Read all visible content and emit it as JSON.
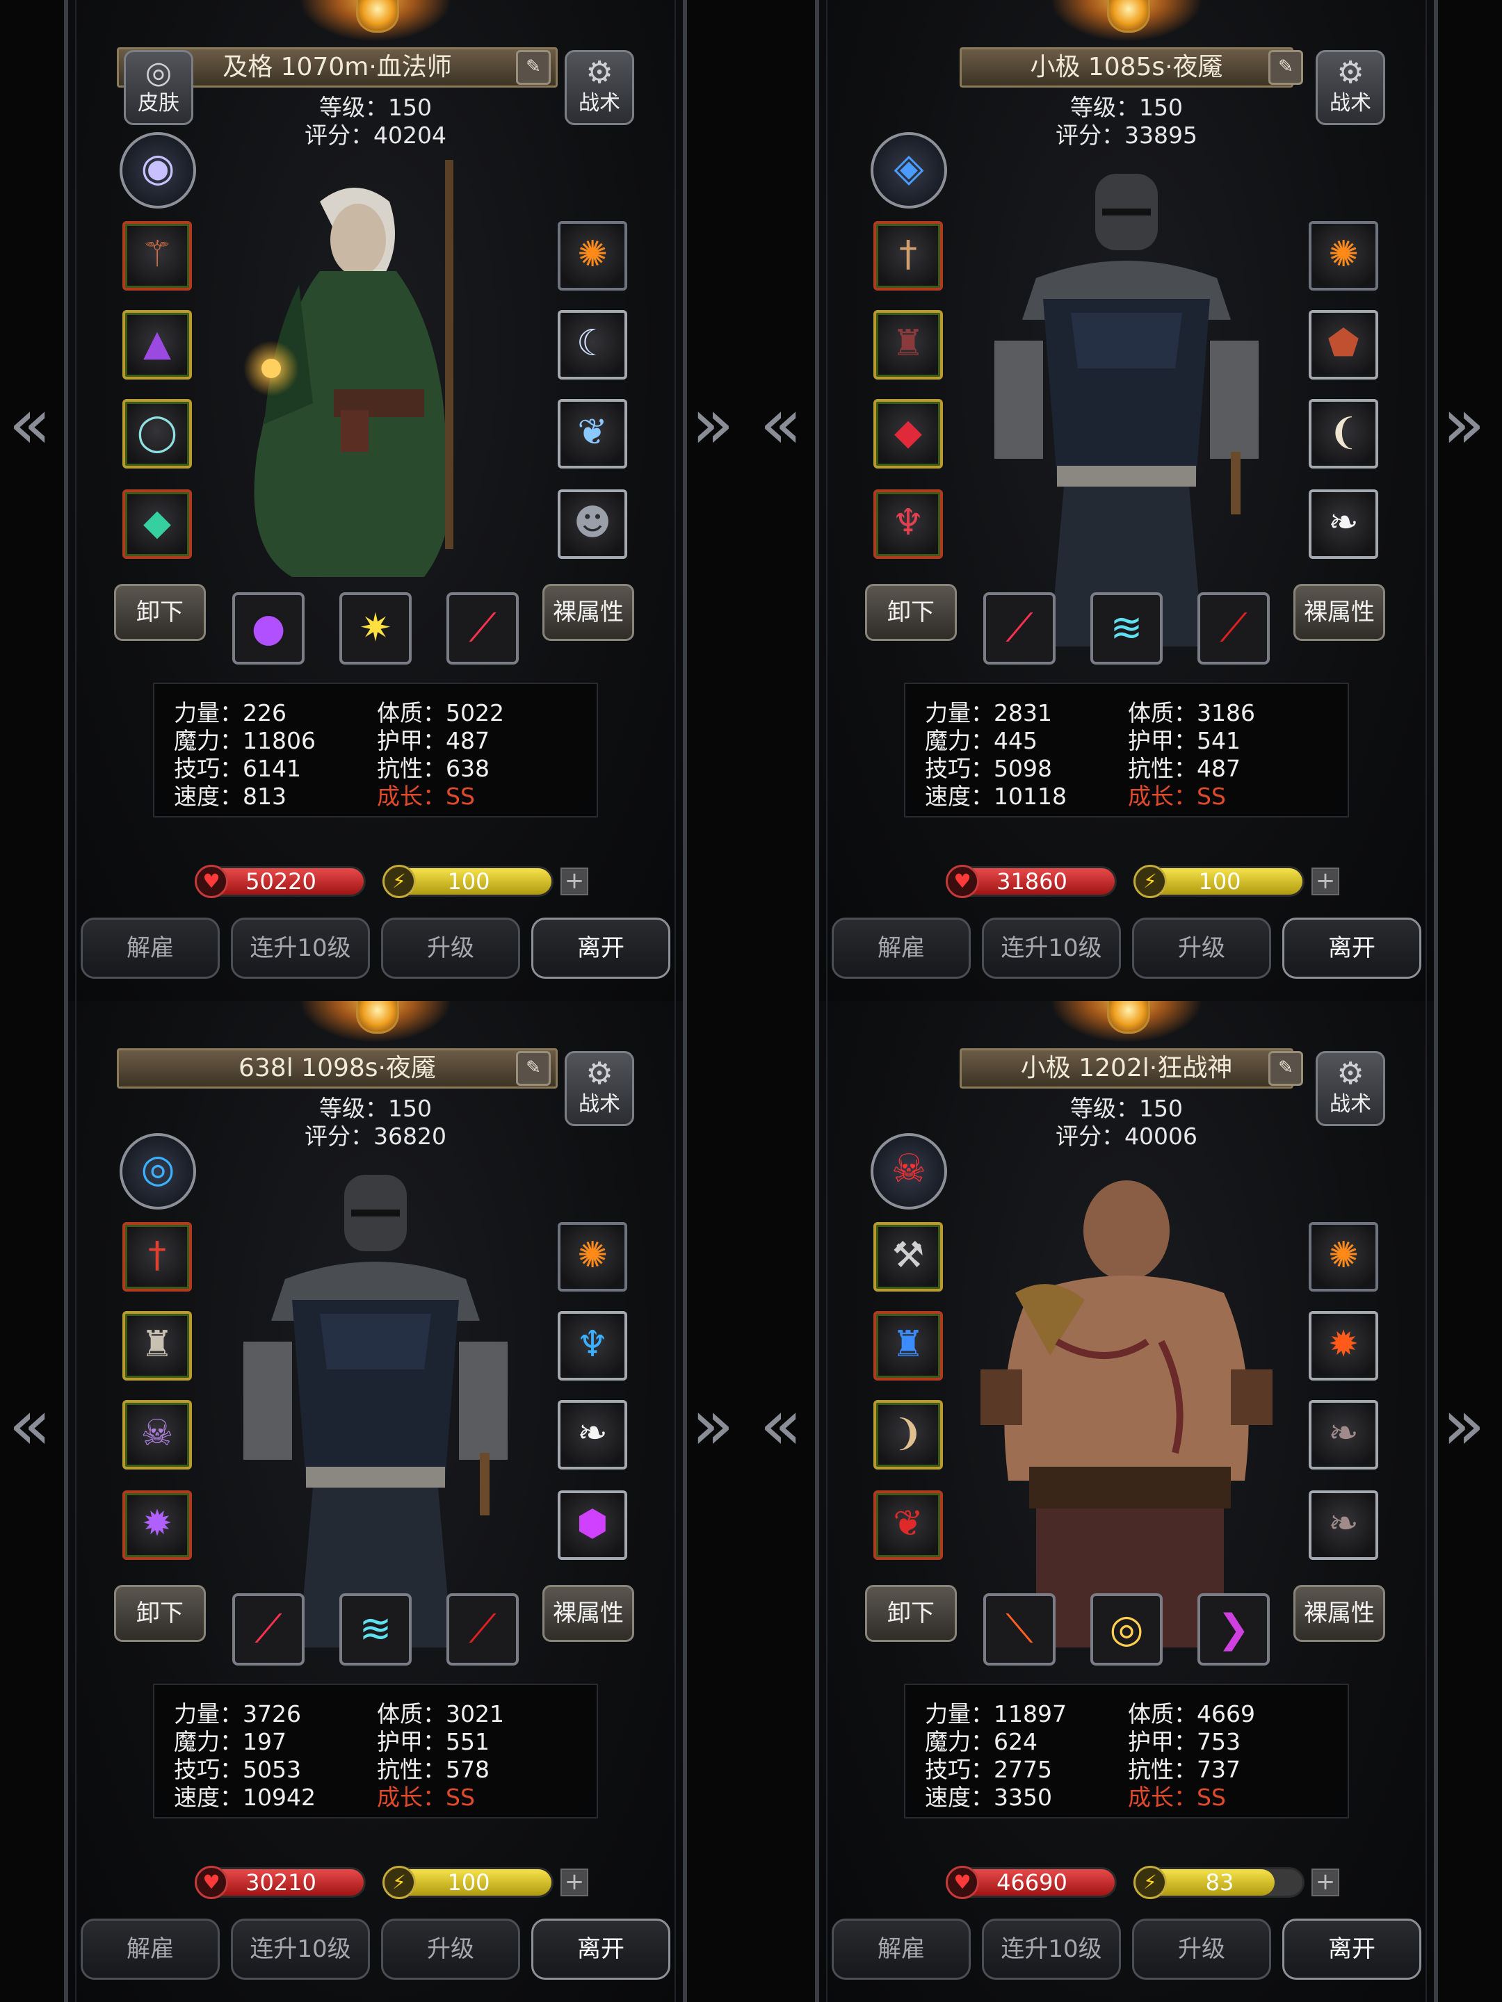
{
  "common": {
    "skin_label": "皮肤",
    "tactics_label": "战术",
    "unload_label": "卸下",
    "naked_label": "裸属性",
    "dismiss_label": "解雇",
    "upgrade10_label": "连升10级",
    "upgrade_label": "升级",
    "leave_label": "离开",
    "prev_arrow": "«",
    "next_arrow": "»",
    "plus": "+",
    "colors": {
      "growth": "#e04a2a",
      "hp": "#c81e1e",
      "energy": "#e6d020"
    }
  },
  "cards": [
    {
      "name": "及格 1070m·血法师",
      "level": "等级：150",
      "score": "评分：40204",
      "class_icon": "arcane-orb-icon",
      "portrait": "elf-blood-mage",
      "left_slots": [
        "staff-icon",
        "purple-cloak-icon",
        "silver-ring-icon",
        "emerald-amulet-icon"
      ],
      "right_slots": [
        "fire-cloud-icon",
        "crescent-moon-icon",
        "blue-feather-icon",
        "stone-mask-icon"
      ],
      "skills": [
        "purple-orbs-icon",
        "golden-burst-icon",
        "crimson-slash-icon"
      ],
      "stats": {
        "str": "力量：226",
        "vit": "体质：5022",
        "mag": "魔力：11806",
        "arm": "护甲：487",
        "skl": "技巧：6141",
        "res": "抗性：638",
        "spd": "速度：813",
        "growth": "成长：SS"
      },
      "hp": "50220",
      "energy": "100",
      "energy_fraction": 1.0
    },
    {
      "name": "小极 1085s·夜魇",
      "level": "等级：150",
      "score": "评分：33895",
      "class_icon": "blue-eye-icon",
      "portrait": "night-assassin",
      "left_slots": [
        "dagger-icon",
        "dark-armor-icon",
        "ruby-amulet-icon",
        "demon-pendant-icon"
      ],
      "right_slots": [
        "fire-cloud-icon",
        "lava-stone-icon",
        "white-fang-icon",
        "white-feather-icon"
      ],
      "skills": [
        "crimson-slash-icon",
        "ice-wind-icon",
        "blood-strike-icon"
      ],
      "stats": {
        "str": "力量：2831",
        "vit": "体质：3186",
        "mag": "魔力：445",
        "arm": "护甲：541",
        "skl": "技巧：5098",
        "res": "抗性：487",
        "spd": "速度：10118",
        "growth": "成长：SS"
      },
      "hp": "31860",
      "energy": "100",
      "energy_fraction": 1.0
    },
    {
      "name": "638l 1098s·夜魇",
      "level": "等级：150",
      "score": "评分：36820",
      "class_icon": "blue-vortex-icon",
      "portrait": "night-assassin",
      "left_slots": [
        "red-dagger-icon",
        "bone-armor-icon",
        "skull-orb-icon",
        "spider-gem-icon"
      ],
      "right_slots": [
        "fire-cloud-icon",
        "blue-trident-icon",
        "white-feather-icon",
        "violet-crystal-icon"
      ],
      "skills": [
        "crimson-slash-icon",
        "ice-wind-icon",
        "blood-strike-icon"
      ],
      "stats": {
        "str": "力量：3726",
        "vit": "体质：3021",
        "mag": "魔力：197",
        "arm": "护甲：551",
        "skl": "技巧：5053",
        "res": "抗性：578",
        "spd": "速度：10942",
        "growth": "成长：SS"
      },
      "hp": "30210",
      "energy": "100",
      "energy_fraction": 1.0
    },
    {
      "name": "小极 1202l·狂战神",
      "level": "等级：150",
      "score": "评分：40006",
      "class_icon": "demon-mask-icon",
      "portrait": "berserker",
      "left_slots": [
        "battle-axe-icon",
        "frost-armor-icon",
        "horn-talisman-icon",
        "blood-tree-icon"
      ],
      "right_slots": [
        "fire-cloud-icon",
        "flame-orb-icon",
        "grey-feather-icon",
        "grey-feather-icon"
      ],
      "skills": [
        "fire-slash-icon",
        "golden-whirl-icon",
        "violet-claw-icon"
      ],
      "stats": {
        "str": "力量：11897",
        "vit": "体质：4669",
        "mag": "魔力：624",
        "arm": "护甲：753",
        "skl": "技巧：2775",
        "res": "抗性：737",
        "spd": "速度：3350",
        "growth": "成长：SS"
      },
      "hp": "46690",
      "energy": "83",
      "energy_fraction": 0.83
    }
  ]
}
